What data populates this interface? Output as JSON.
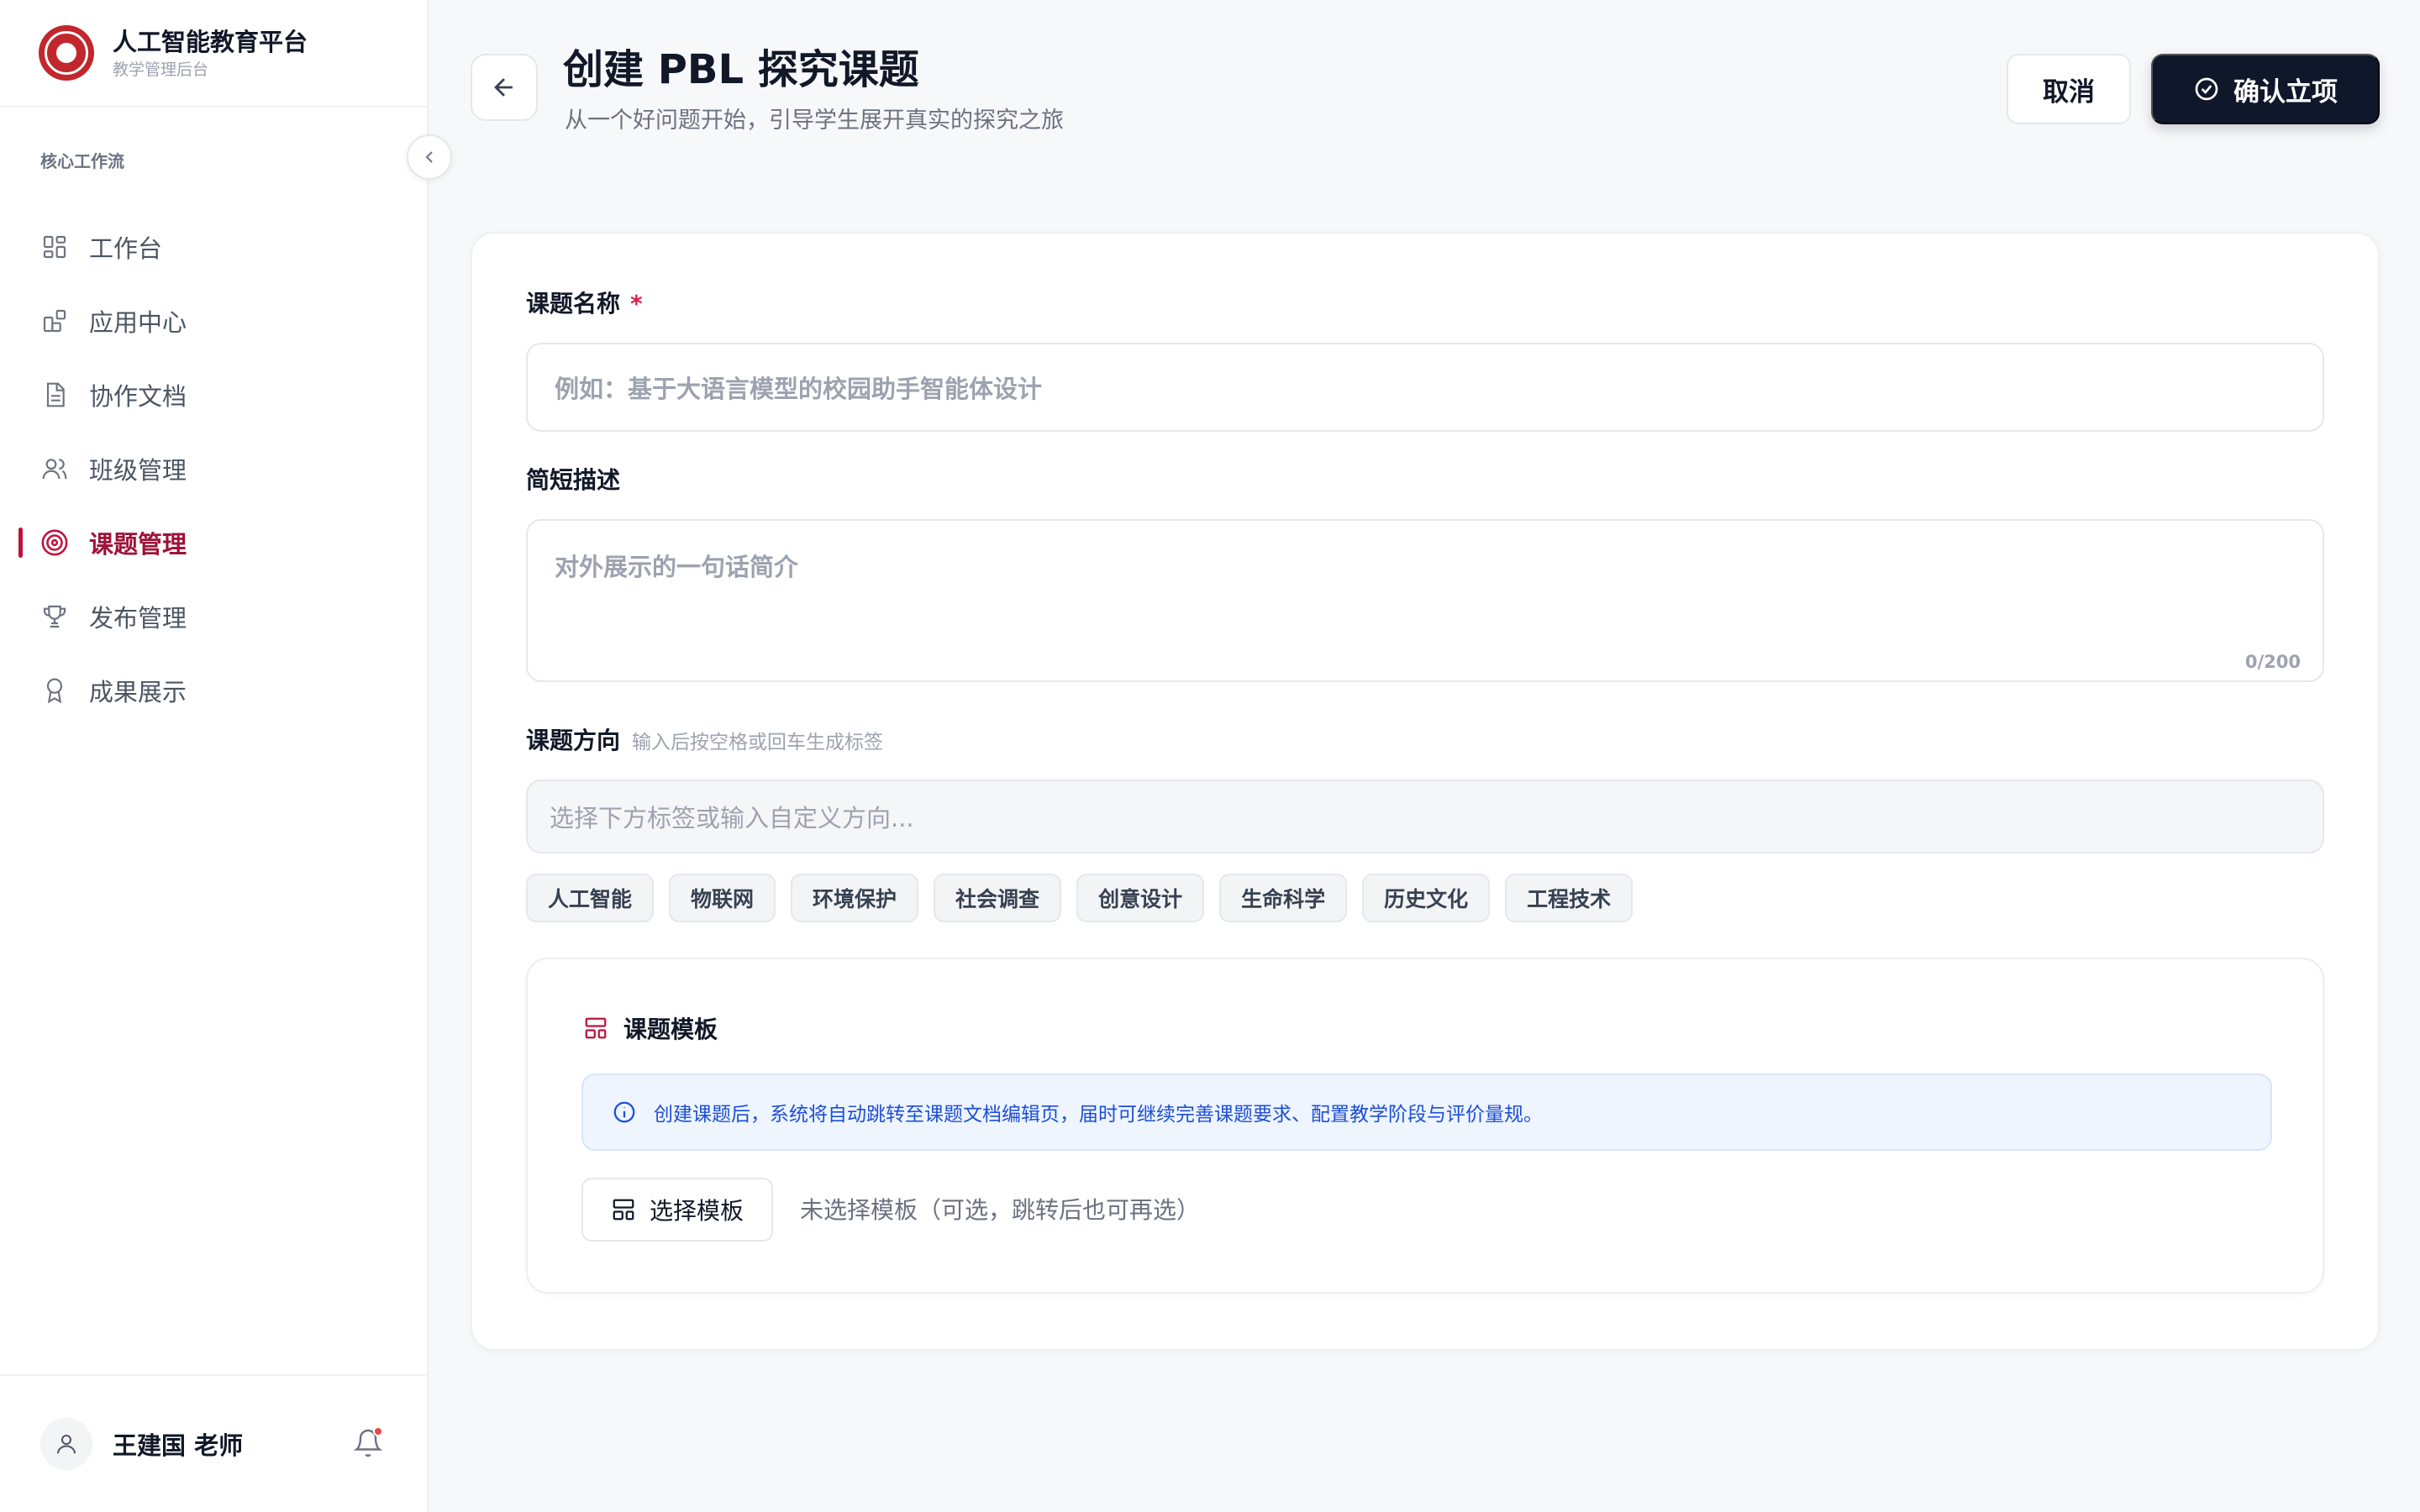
{
  "brand": {
    "name": "人工智能教育平台",
    "subtitle": "教学管理后台"
  },
  "sidebar": {
    "section_label": "核心工作流",
    "items": [
      {
        "label": "工作台",
        "icon": "dashboard-icon",
        "active": false
      },
      {
        "label": "应用中心",
        "icon": "apps-icon",
        "active": false
      },
      {
        "label": "协作文档",
        "icon": "document-icon",
        "active": false
      },
      {
        "label": "班级管理",
        "icon": "users-icon",
        "active": false
      },
      {
        "label": "课题管理",
        "icon": "target-icon",
        "active": true
      },
      {
        "label": "发布管理",
        "icon": "trophy-icon",
        "active": false
      },
      {
        "label": "成果展示",
        "icon": "award-icon",
        "active": false
      }
    ],
    "user": {
      "name": "王建国 老师"
    }
  },
  "header": {
    "title": "创建 PBL 探究课题",
    "subtitle": "从一个好问题开始，引导学生展开真实的探究之旅",
    "cancel_label": "取消",
    "confirm_label": "确认立项"
  },
  "form": {
    "topic_name": {
      "label": "课题名称",
      "required_mark": "*",
      "placeholder": "例如：基于大语言模型的校园助手智能体设计",
      "value": ""
    },
    "description": {
      "label": "简短描述",
      "placeholder": "对外展示的一句话简介",
      "counter": "0/200",
      "value": ""
    },
    "direction": {
      "label": "课题方向",
      "hint": "输入后按空格或回车生成标签",
      "placeholder": "选择下方标签或输入自定义方向...",
      "tags": [
        "人工智能",
        "物联网",
        "环境保护",
        "社会调查",
        "创意设计",
        "生命科学",
        "历史文化",
        "工程技术"
      ]
    },
    "template": {
      "title": "课题模板",
      "info": "创建课题后，系统将自动跳转至课题文档编辑页，届时可继续完善课题要求、配置教学阶段与评价量规。",
      "select_label": "选择模板",
      "status": "未选择模板（可选，跳转后也可再选）"
    }
  },
  "colors": {
    "accent": "#be123c",
    "primary_button": "#0f172a",
    "info_bg": "#eef5ff",
    "info_text": "#1d4ed8",
    "logo": "#c1272d"
  }
}
